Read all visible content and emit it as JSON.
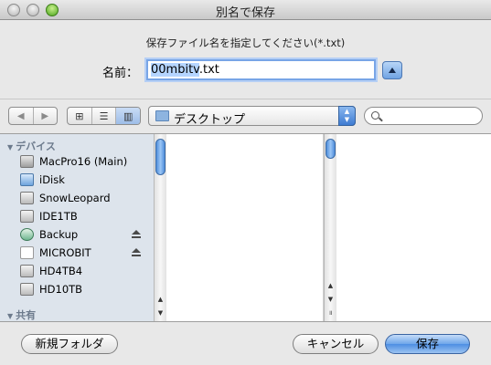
{
  "window": {
    "title": "別名で保存"
  },
  "dialog": {
    "prompt": "保存ファイル名を指定してください(*.txt)",
    "name_label": "名前：",
    "filename_selected": "00mbitv",
    "filename_rest": ".txt"
  },
  "toolbar": {
    "location": "デスクトップ",
    "search_placeholder": ""
  },
  "sidebar": {
    "devices_heading": "デバイス",
    "shared_heading": "共有",
    "devices": [
      {
        "label": "MacPro16 (Main)",
        "icon": "hard-drive-icon"
      },
      {
        "label": "iDisk",
        "icon": "idisk-icon"
      },
      {
        "label": "SnowLeopard",
        "icon": "hard-drive-icon"
      },
      {
        "label": "IDE1TB",
        "icon": "hard-drive-icon"
      },
      {
        "label": "Backup",
        "icon": "time-machine-icon",
        "eject": true
      },
      {
        "label": "MICROBIT",
        "icon": "usb-drive-icon",
        "eject": true
      },
      {
        "label": "HD4TB4",
        "icon": "hard-drive-icon"
      },
      {
        "label": "HD10TB",
        "icon": "hard-drive-icon"
      }
    ]
  },
  "buttons": {
    "new_folder": "新規フォルダ",
    "cancel": "キャンセル",
    "save": "保存"
  }
}
